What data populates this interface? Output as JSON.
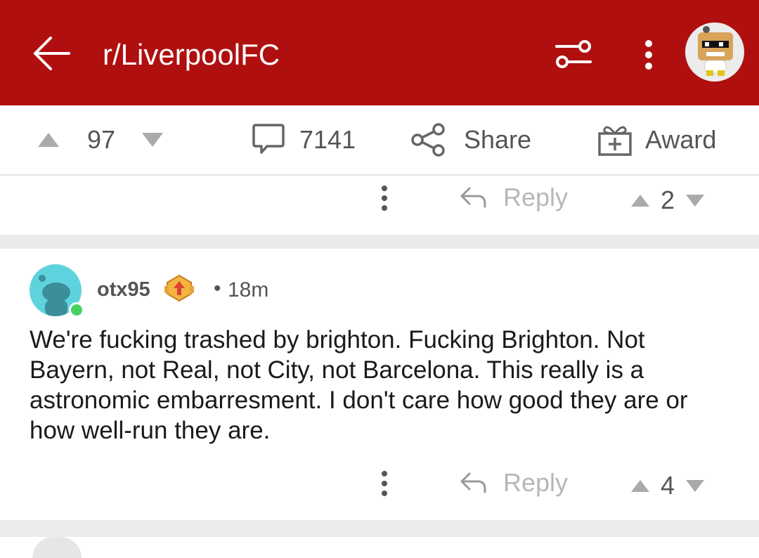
{
  "header": {
    "title": "r/LiverpoolFC",
    "icons": [
      "back-arrow-icon",
      "filter-sliders-icon",
      "kebab-menu-icon",
      "user-avatar"
    ],
    "colors": {
      "bar": "#b00f0f"
    }
  },
  "post_actions": {
    "score": "97",
    "comments": "7141",
    "share_label": "Share",
    "award_label": "Award"
  },
  "prev_comment": {
    "reply_label": "Reply",
    "score": "2"
  },
  "comment": {
    "username": "otx95",
    "separator": "•",
    "time": "18m",
    "text": "We're fucking trashed by brighton. Fucking Brighton. Not Bayern, not Real, not City, not Barcelona. This really is a astronomic embarresment. I don't care how good they are or how well-run they are.",
    "reply_label": "Reply",
    "score": "4",
    "colors": {
      "avatar": "#5ed3de",
      "online": "#46d160"
    }
  }
}
